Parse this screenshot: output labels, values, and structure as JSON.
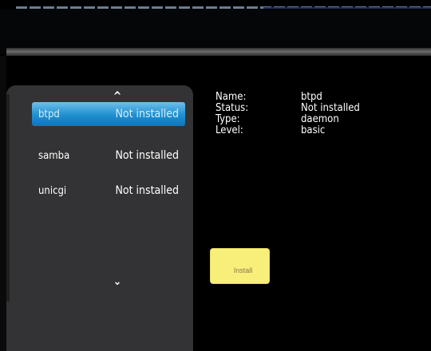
{
  "packages": [
    {
      "name": "btpd",
      "status": "Not installed"
    },
    {
      "name": "samba",
      "status": "Not installed"
    },
    {
      "name": "unicgi",
      "status": "Not installed"
    }
  ],
  "details": {
    "name_label": "Name:",
    "name_value": "btpd",
    "status_label": "Status:",
    "status_value": "Not installed",
    "type_label": "Type:",
    "type_value": "daemon",
    "level_label": "Level:",
    "level_value": "basic"
  },
  "install_button": {
    "label": "Install"
  },
  "icons": {
    "scroll_up": "chevron-up-icon",
    "scroll_down": "chevron-down-icon"
  },
  "colors": {
    "background": "#000000",
    "panel": "#333335",
    "selection": "#1e8fd0",
    "button": "#f8ee7a"
  }
}
